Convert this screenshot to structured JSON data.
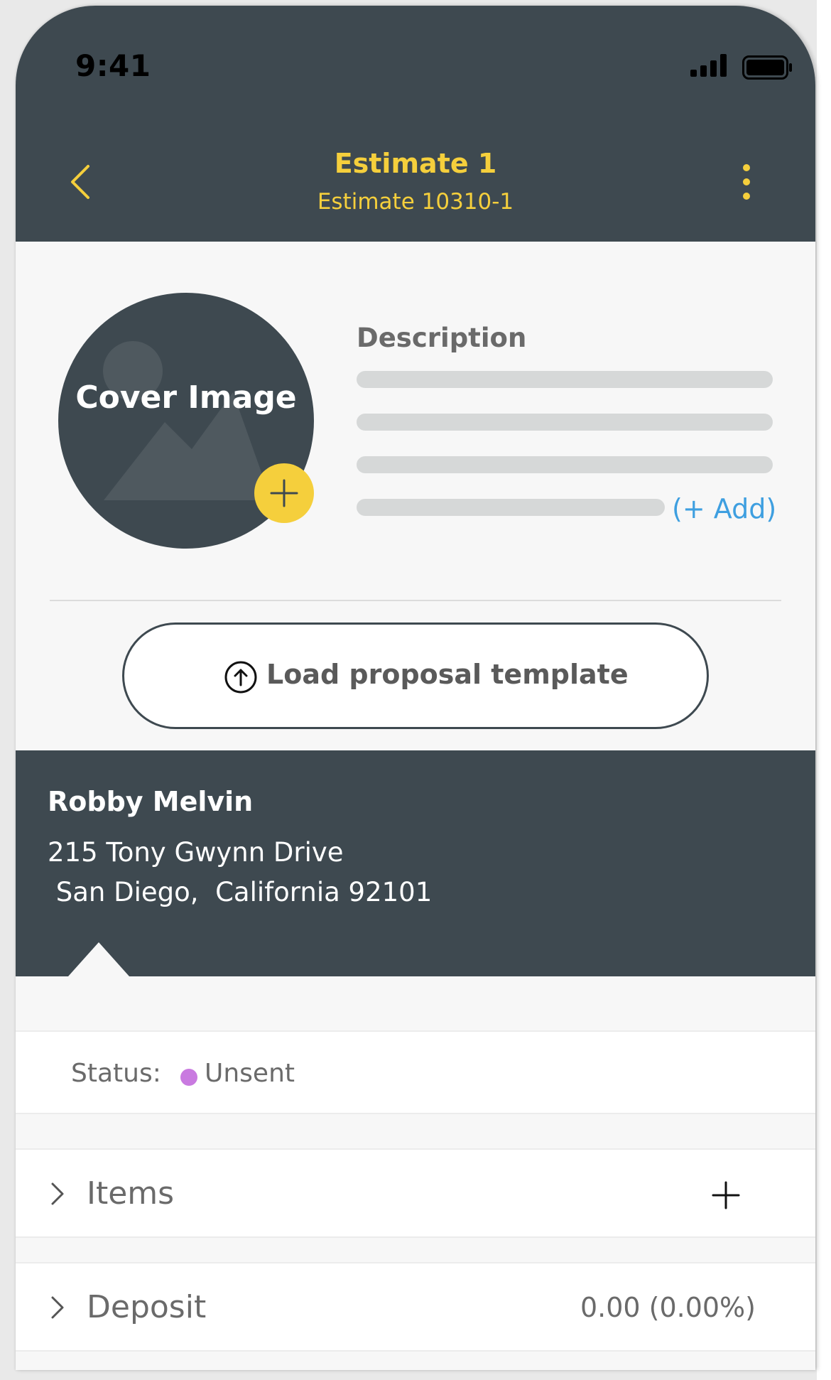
{
  "status_bar": {
    "time": "9:41"
  },
  "header": {
    "title": "Estimate 1",
    "subtitle": "Estimate 10310-1"
  },
  "cover": {
    "label": "Cover Image"
  },
  "description": {
    "title": "Description",
    "add_link": "(+ Add)"
  },
  "template_button": {
    "label": "Load proposal template"
  },
  "client": {
    "name": "Robby Melvin",
    "address": "215 Tony Gwynn Drive\n San Diego,  California 92101"
  },
  "status": {
    "label": "Status:",
    "value": "Unsent",
    "color": "#c97ae0"
  },
  "sections": {
    "items": {
      "label": "Items"
    },
    "deposit": {
      "label": "Deposit",
      "value": "0.00 (0.00%)"
    }
  },
  "colors": {
    "header_bg": "#3e4950",
    "accent": "#f5cf3c",
    "link": "#3e9fe0"
  }
}
